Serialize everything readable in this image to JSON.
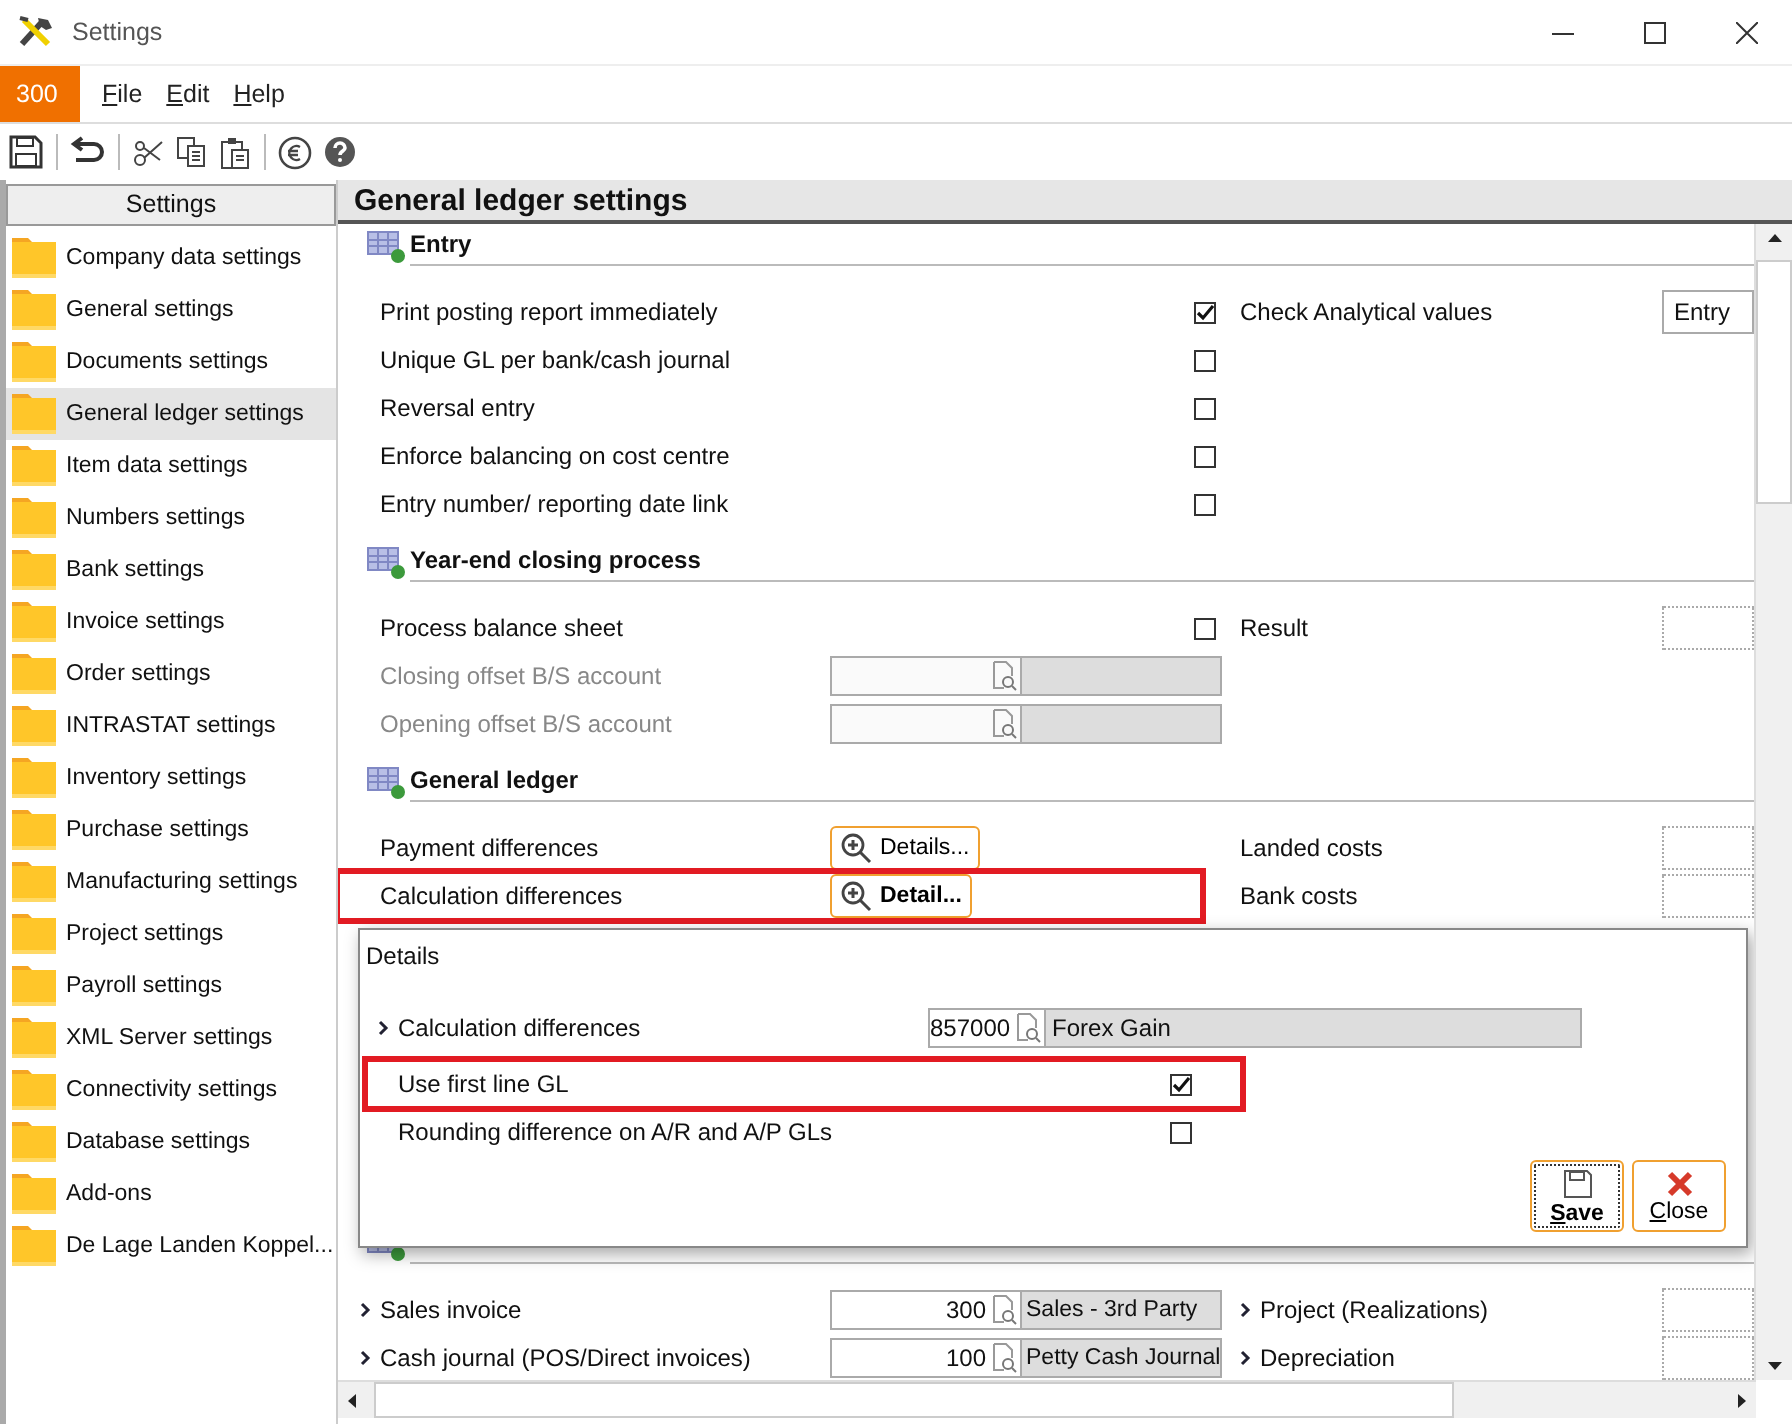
{
  "window": {
    "title": "Settings"
  },
  "menu": {
    "company": "300",
    "items": [
      "File",
      "Edit",
      "Help"
    ]
  },
  "sidebar": {
    "title": "Settings",
    "items": [
      {
        "label": "Company data settings",
        "selected": false
      },
      {
        "label": "General settings",
        "selected": false
      },
      {
        "label": "Documents settings",
        "selected": false
      },
      {
        "label": "General ledger settings",
        "selected": true
      },
      {
        "label": "Item data settings",
        "selected": false
      },
      {
        "label": "Numbers settings",
        "selected": false
      },
      {
        "label": "Bank settings",
        "selected": false
      },
      {
        "label": "Invoice settings",
        "selected": false
      },
      {
        "label": "Order settings",
        "selected": false
      },
      {
        "label": "INTRASTAT settings",
        "selected": false
      },
      {
        "label": "Inventory settings",
        "selected": false
      },
      {
        "label": "Purchase settings",
        "selected": false
      },
      {
        "label": "Manufacturing settings",
        "selected": false
      },
      {
        "label": "Project settings",
        "selected": false
      },
      {
        "label": "Payroll settings",
        "selected": false
      },
      {
        "label": "XML Server settings",
        "selected": false
      },
      {
        "label": "Connectivity settings",
        "selected": false
      },
      {
        "label": "Database settings",
        "selected": false
      },
      {
        "label": "Add-ons",
        "selected": false
      },
      {
        "label": "De Lage Landen Koppel...",
        "selected": false
      }
    ]
  },
  "page": {
    "title": "General ledger settings",
    "sections": [
      {
        "title": "Entry",
        "rows": [
          {
            "kind": "checkbox",
            "label": "Print posting report immediately",
            "checked": true,
            "right": {
              "kind": "select",
              "label": "Check Analytical values",
              "value": "Entry"
            }
          },
          {
            "kind": "checkbox",
            "label": "Unique GL per bank/cash journal",
            "checked": false
          },
          {
            "kind": "checkbox",
            "label": "Reversal entry",
            "checked": false
          },
          {
            "kind": "checkbox",
            "label": "Enforce balancing on cost centre",
            "checked": false
          },
          {
            "kind": "checkbox",
            "label": "Entry number/ reporting date link",
            "checked": false
          }
        ]
      },
      {
        "title": "Year-end closing process",
        "rows": [
          {
            "kind": "checkbox",
            "label": "Process balance sheet",
            "checked": false,
            "right": {
              "kind": "field",
              "label": "Result"
            }
          },
          {
            "kind": "lookup",
            "label": "Closing offset B/S account",
            "disabled": true
          },
          {
            "kind": "lookup",
            "label": "Opening offset B/S account",
            "disabled": true
          }
        ]
      },
      {
        "title": "General ledger",
        "rows": [
          {
            "kind": "button",
            "label": "Payment differences",
            "button": "Details...",
            "focused": false,
            "highlighted": false,
            "right": {
              "kind": "field",
              "label": "Landed costs"
            }
          },
          {
            "kind": "button",
            "label": "Calculation differences",
            "button": "Detail...",
            "focused": true,
            "highlighted": true,
            "right": {
              "kind": "field",
              "label": "Bank costs"
            }
          }
        ]
      },
      {
        "gap": true,
        "rows": [
          {
            "kind": "lookup",
            "label": "Sales invoice",
            "chevron": true,
            "value": "300",
            "description": "Sales - 3rd Party",
            "right": {
              "kind": "field",
              "label": "Project (Realizations)",
              "chevron": true
            }
          },
          {
            "kind": "lookup",
            "label": "Cash journal (POS/Direct invoices)",
            "chevron": true,
            "value": "100",
            "description": "Petty Cash Journal",
            "right": {
              "kind": "field",
              "label": "Depreciation",
              "chevron": true
            }
          }
        ]
      }
    ]
  },
  "dialog": {
    "title": "Details",
    "rows": [
      {
        "kind": "lookup",
        "label": "Calculation differences",
        "chevron": true,
        "value": "857000",
        "description": "Forex Gain"
      },
      {
        "kind": "checkbox",
        "label": "Use first line GL",
        "checked": true,
        "highlighted": true
      },
      {
        "kind": "checkbox",
        "label": "Rounding difference on A/R and A/P GLs",
        "checked": false
      }
    ],
    "buttons": [
      {
        "kind": "save",
        "label": "Save",
        "focused": true
      },
      {
        "kind": "close",
        "label": "Close",
        "focused": false
      }
    ]
  }
}
